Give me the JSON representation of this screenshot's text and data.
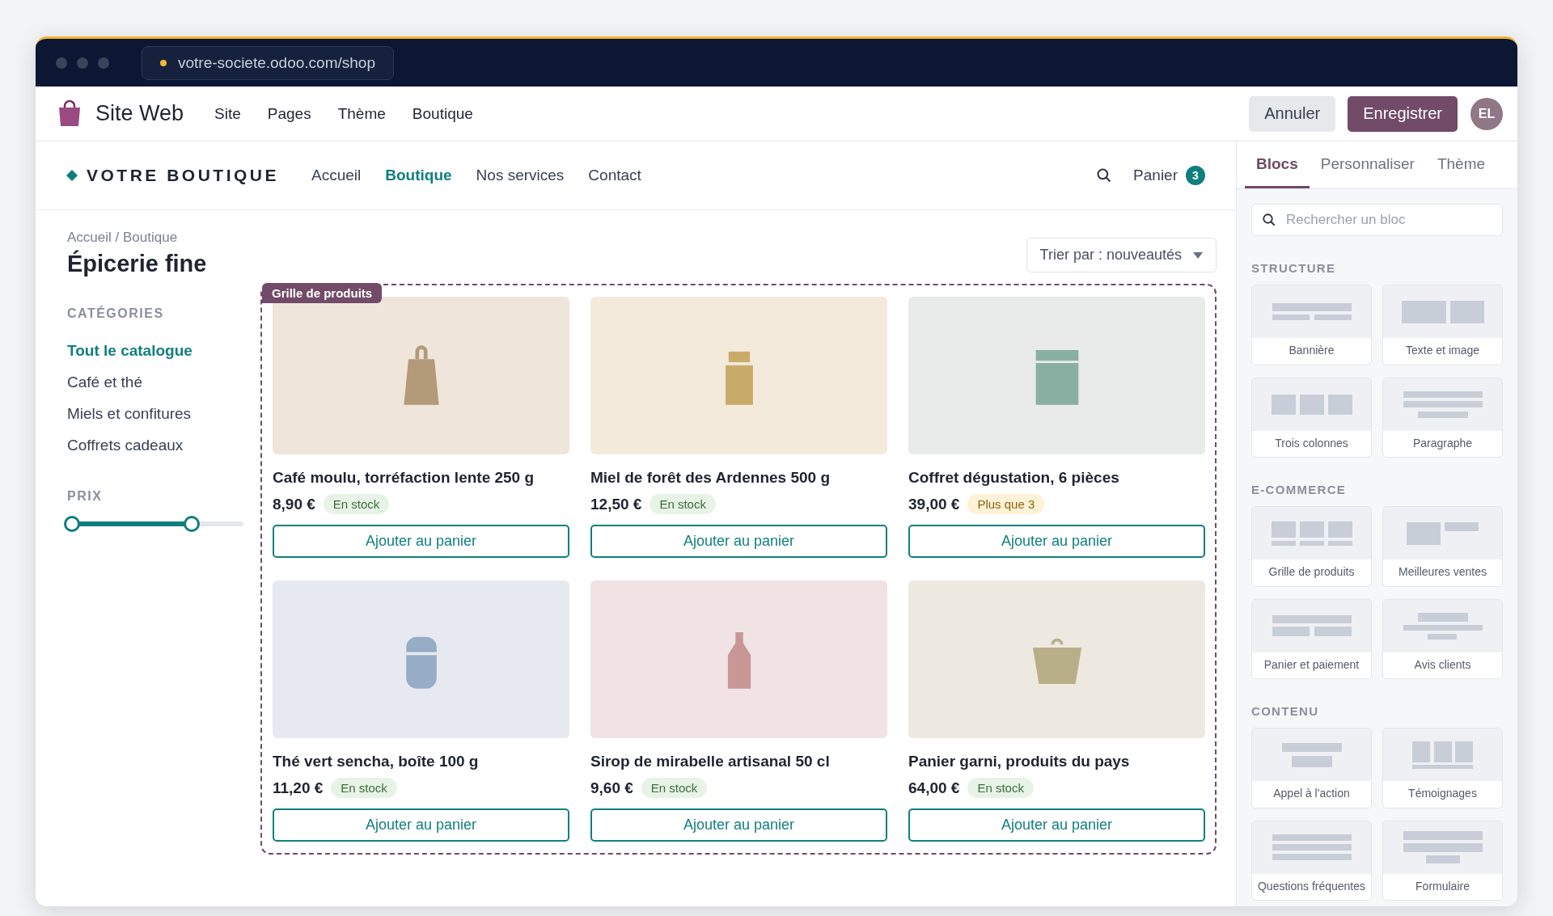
{
  "browser": {
    "url": "votre-societe.odoo.com/shop"
  },
  "editor_bar": {
    "app_name": "Site Web",
    "menu": [
      "Site",
      "Pages",
      "Thème",
      "Boutique"
    ],
    "cancel": "Annuler",
    "save": "Enregistrer",
    "avatar": "EL"
  },
  "store_header": {
    "brand": "VOTRE BOUTIQUE",
    "nav": [
      {
        "label": "Accueil",
        "selected": false
      },
      {
        "label": "Boutique",
        "selected": true
      },
      {
        "label": "Nos services",
        "selected": false
      },
      {
        "label": "Contact",
        "selected": false
      }
    ],
    "cart_label": "Panier",
    "cart_count": "3"
  },
  "breadcrumb": "Accueil / Boutique",
  "page_title": "Épicerie fine",
  "sort": "Trier par : nouveautés",
  "sidebar": {
    "categories_title": "CATÉGORIES",
    "categories": [
      {
        "label": "Tout le catalogue",
        "selected": true
      },
      {
        "label": "Café et thé",
        "selected": false
      },
      {
        "label": "Miels et confitures",
        "selected": false
      },
      {
        "label": "Coffrets cadeaux",
        "selected": false
      }
    ],
    "price_title": "PRIX",
    "price_range": {
      "level": 0.7
    }
  },
  "grid_label": "Grille de produits",
  "products": [
    {
      "name": "Café moulu, torréfaction lente 250 g",
      "price": "8,90 €",
      "stock": {
        "text": "En stock",
        "kind": "ok"
      },
      "kind": "bag",
      "button": "Ajouter au panier"
    },
    {
      "name": "Miel de forêt des Ardennes 500 g",
      "price": "12,50 €",
      "stock": {
        "text": "En stock",
        "kind": "ok"
      },
      "kind": "jar",
      "button": "Ajouter au panier"
    },
    {
      "name": "Coffret dégustation, 6 pièces",
      "price": "39,00 €",
      "stock": {
        "text": "Plus que 3",
        "kind": "low"
      },
      "kind": "box",
      "button": "Ajouter au panier"
    },
    {
      "name": "Thé vert sencha, boîte 100 g",
      "price": "11,20 €",
      "stock": {
        "text": "En stock",
        "kind": "ok"
      },
      "kind": "tin",
      "button": "Ajouter au panier"
    },
    {
      "name": "Sirop de mirabelle artisanal 50 cl",
      "price": "9,60 €",
      "stock": {
        "text": "En stock",
        "kind": "ok"
      },
      "kind": "bottle",
      "button": "Ajouter au panier"
    },
    {
      "name": "Panier garni, produits du pays",
      "price": "64,00 €",
      "stock": {
        "text": "En stock",
        "kind": "ok"
      },
      "kind": "basket",
      "button": "Ajouter au panier"
    }
  ],
  "panel": {
    "tabs": [
      {
        "label": "Blocs",
        "selected": true
      },
      {
        "label": "Personnaliser",
        "selected": false
      },
      {
        "label": "Thème",
        "selected": false
      }
    ],
    "search": {
      "placeholder": "Rechercher un bloc"
    },
    "sections": [
      {
        "title": "STRUCTURE",
        "blocks": [
          {
            "label": "Bannière",
            "kind": "banner"
          },
          {
            "label": "Texte et image",
            "kind": "text_image"
          },
          {
            "label": "Trois colonnes",
            "kind": "three_columns"
          },
          {
            "label": "Paragraphe",
            "kind": "paragraph"
          }
        ]
      },
      {
        "title": "E-COMMERCE",
        "blocks": [
          {
            "label": "Grille de produits",
            "kind": "product_grid"
          },
          {
            "label": "Meilleures ventes",
            "kind": "best_sellers"
          },
          {
            "label": "Panier et paiement",
            "kind": "cart"
          },
          {
            "label": "Avis clients",
            "kind": "reviews"
          }
        ]
      },
      {
        "title": "CONTENU",
        "blocks": [
          {
            "label": "Appel à l'action",
            "kind": "cta"
          },
          {
            "label": "Témoignages",
            "kind": "testimonials"
          },
          {
            "label": "Questions fréquentes",
            "kind": "faq"
          },
          {
            "label": "Formulaire",
            "kind": "form"
          }
        ]
      }
    ]
  }
}
